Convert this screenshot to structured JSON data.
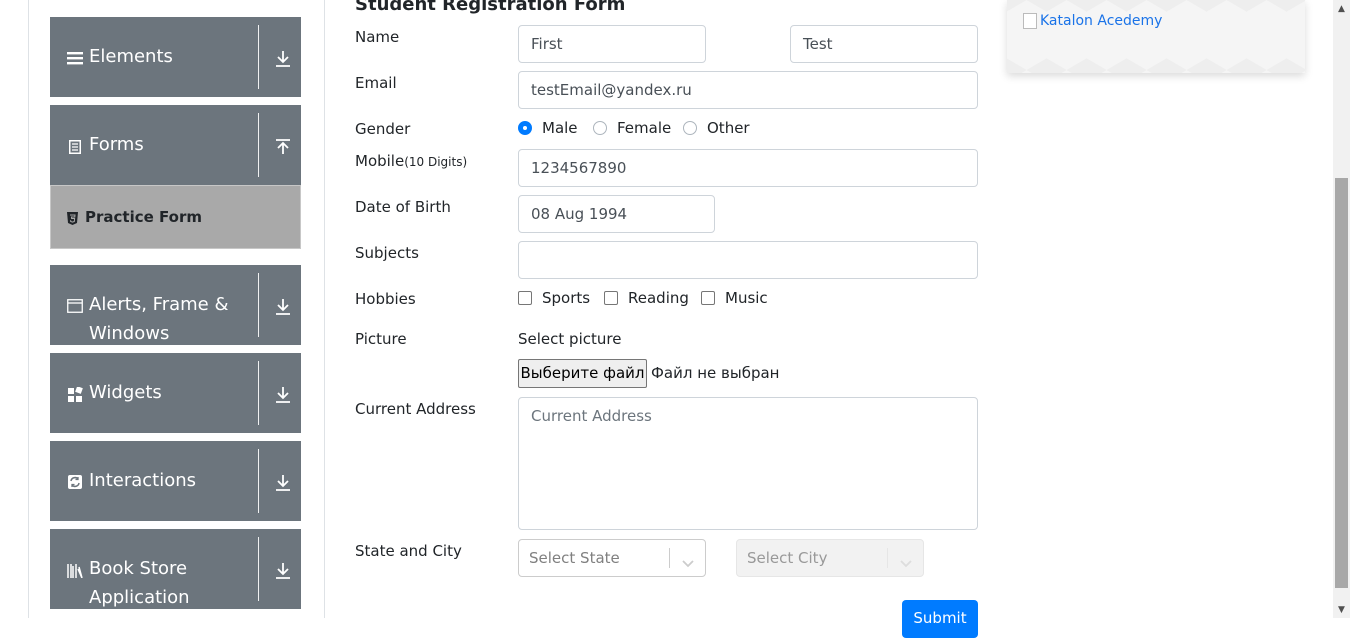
{
  "sidebar": {
    "groups": [
      {
        "label": "Elements",
        "icon": "hamburger-icon",
        "arrow": "down"
      },
      {
        "label": "Forms",
        "icon": "document-icon",
        "arrow": "up"
      },
      {
        "label": "Alerts, Frame & Windows",
        "icon": "window-icon",
        "arrow": "down"
      },
      {
        "label": "Widgets",
        "icon": "widgets-icon",
        "arrow": "down"
      },
      {
        "label": "Interactions",
        "icon": "interactions-icon",
        "arrow": "down"
      },
      {
        "label": "Book Store Application",
        "icon": "books-icon",
        "arrow": "down"
      }
    ],
    "active_item": {
      "label": "Practice Form",
      "icon": "html5-icon"
    },
    "colors": {
      "group_bg": "#6c757d",
      "active_bg": "#a9a9a9"
    }
  },
  "form": {
    "title": "Student Registration Form",
    "labels": {
      "name": "Name",
      "email": "Email",
      "gender": "Gender",
      "mobile": "Mobile",
      "mobile_hint": "(10 Digits)",
      "dob": "Date of Birth",
      "subjects": "Subjects",
      "hobbies": "Hobbies",
      "picture": "Picture",
      "current_address": "Current Address",
      "state_city": "State and City"
    },
    "first_name": "First",
    "last_name": "Test",
    "email": "testEmail@yandex.ru",
    "gender_options": [
      "Male",
      "Female",
      "Other"
    ],
    "gender_selected": "Male",
    "mobile": "1234567890",
    "dob": "08 Aug 1994",
    "subjects": "",
    "hobbies": [
      "Sports",
      "Reading",
      "Music"
    ],
    "picture_label": "Select picture",
    "file_button": "Выберите файл",
    "file_status": "Файл не выбран",
    "address_placeholder": "Current Address",
    "state_placeholder": "Select State",
    "city_placeholder": "Select City",
    "submit": "Submit",
    "colors": {
      "primary": "#007bff"
    }
  },
  "ad": {
    "alt_text": "Katalon Acedemy"
  }
}
